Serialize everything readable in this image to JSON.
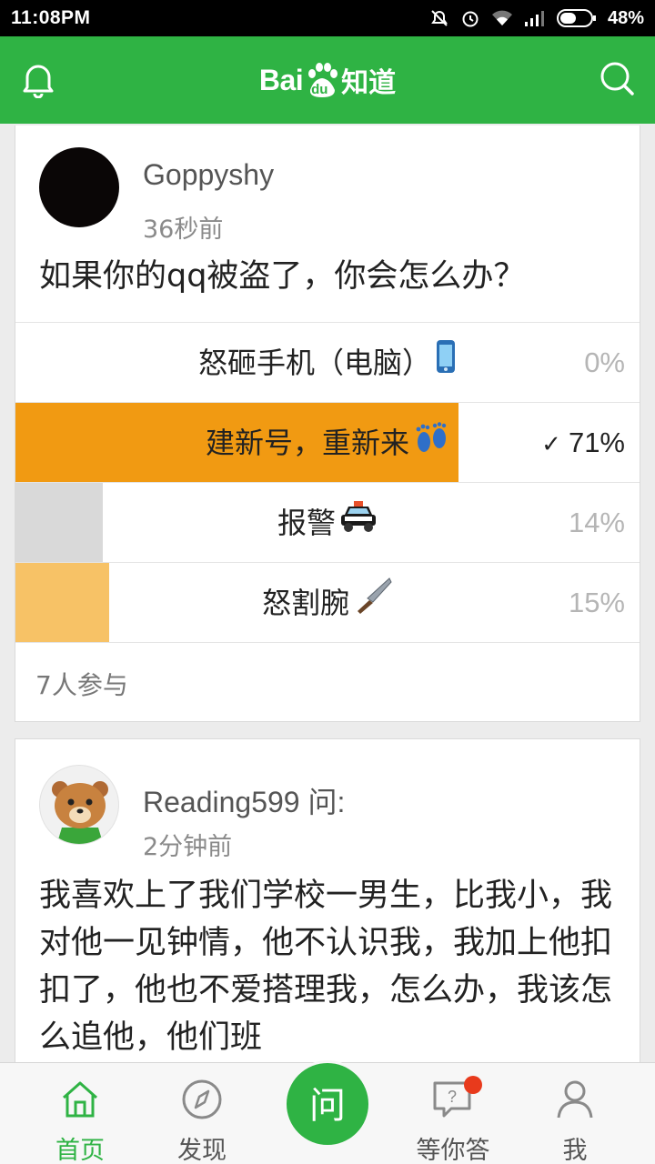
{
  "status_bar": {
    "time": "11:08PM",
    "battery": "48%"
  },
  "header": {
    "logo_bai": "Bai",
    "logo_du": "du",
    "logo_zhidao": "知道"
  },
  "card1": {
    "username": "Goppyshy",
    "time_ago": "36秒前",
    "question": "如果你的qq被盗了，你会怎么办？",
    "options": [
      {
        "label": "怒砸手机（电脑）",
        "percent": "0%",
        "fraction": 0.0,
        "emoji": "phone-emoji"
      },
      {
        "label": "建新号，重新来",
        "percent": "71%",
        "fraction": 0.71,
        "emoji": "footprints-emoji",
        "selected": true,
        "check": "✓"
      },
      {
        "label": "报警",
        "percent": "14%",
        "fraction": 0.14,
        "emoji": "police-car-emoji"
      },
      {
        "label": "怒割腕",
        "percent": "15%",
        "fraction": 0.15,
        "emoji": "knife-emoji"
      }
    ],
    "participants": "7人参与"
  },
  "card2": {
    "username": "Reading599 问:",
    "time_ago": "2分钟前",
    "question": "我喜欢上了我们学校一男生，比我小，我对他一见钟情，他不认识我，我加上他扣扣了，他也不爱搭理我，怎么办，我该怎么追他，他们班"
  },
  "bottom_nav": {
    "home": "首页",
    "discover": "发现",
    "ask": "问",
    "waiting": "等你答",
    "me": "我"
  },
  "colors": {
    "brand": "#2fb344",
    "selected_bar": "#f19a12",
    "bar_grey": "#d9d9d9",
    "bar_light_orange": "#f7c266",
    "badge": "#e83a1c"
  }
}
